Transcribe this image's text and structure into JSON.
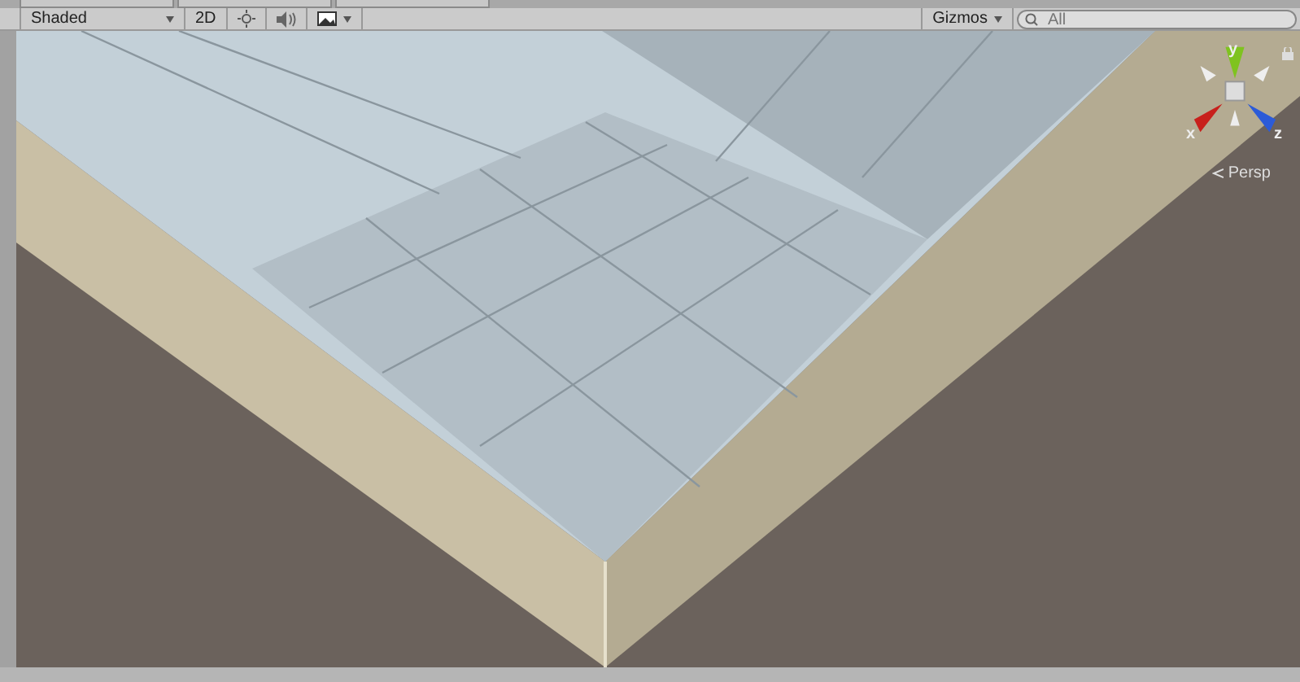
{
  "toolbar": {
    "draw_mode": "Shaded",
    "mode_2d": "2D",
    "gizmos": "Gizmos",
    "search": {
      "placeholder": "All"
    }
  },
  "scene_gizmo": {
    "axes": [
      {
        "label": "y",
        "color": "#7fc31f"
      },
      {
        "label": "x",
        "color": "#c8201c"
      },
      {
        "label": "z",
        "color": "#2c5bd8"
      }
    ],
    "projection": "Persp"
  }
}
